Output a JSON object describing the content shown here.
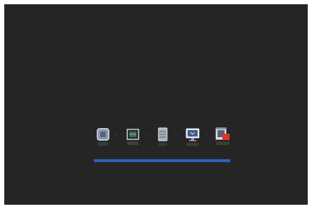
{
  "window": {
    "background": "#252525",
    "frame": "#ffffff"
  },
  "boot_steps": [
    {
      "name": "chip-icon"
    },
    {
      "name": "board-icon"
    },
    {
      "name": "server-icon"
    },
    {
      "name": "monitor-icon"
    },
    {
      "name": "film-rec-icon",
      "badge": "REC"
    }
  ],
  "separator_glyph": "›",
  "progress": {
    "fraction": 1.0,
    "color": "#2f5fc4"
  }
}
